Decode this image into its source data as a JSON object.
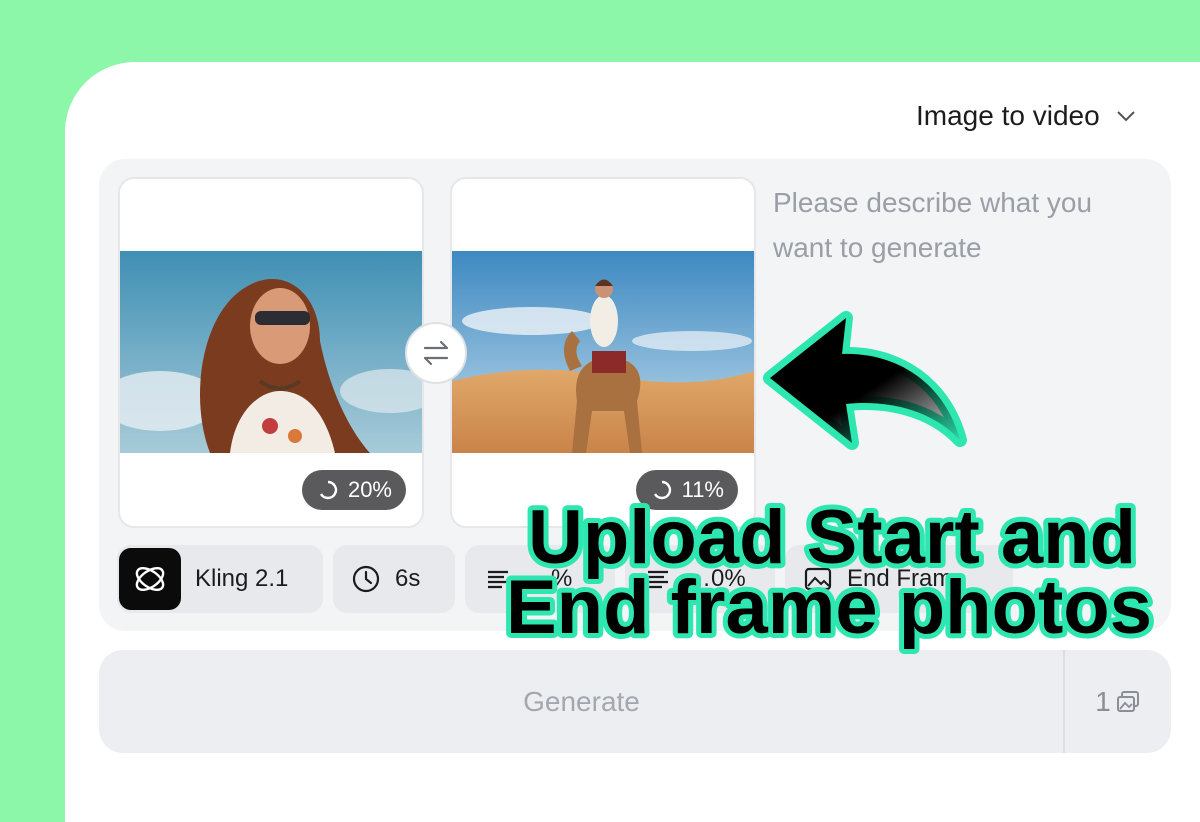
{
  "header": {
    "mode_label": "Image to video"
  },
  "frames": {
    "start": {
      "progress": "20%"
    },
    "end": {
      "progress": "11%"
    }
  },
  "prompt": {
    "placeholder": "Please describe what you want to generate"
  },
  "options": {
    "model": "Kling 2.1",
    "duration": "6s",
    "chip_a": "…%",
    "chip_b": "…0%",
    "end_frame": "End Frame"
  },
  "actions": {
    "generate_label": "Generate",
    "count": "1"
  },
  "overlay": {
    "line1": "Upload Start and",
    "line2": "End frame photos"
  },
  "colors": {
    "background": "#8cf7a9",
    "overlay_text": "#000000",
    "overlay_outline": "#2ee6b0"
  }
}
